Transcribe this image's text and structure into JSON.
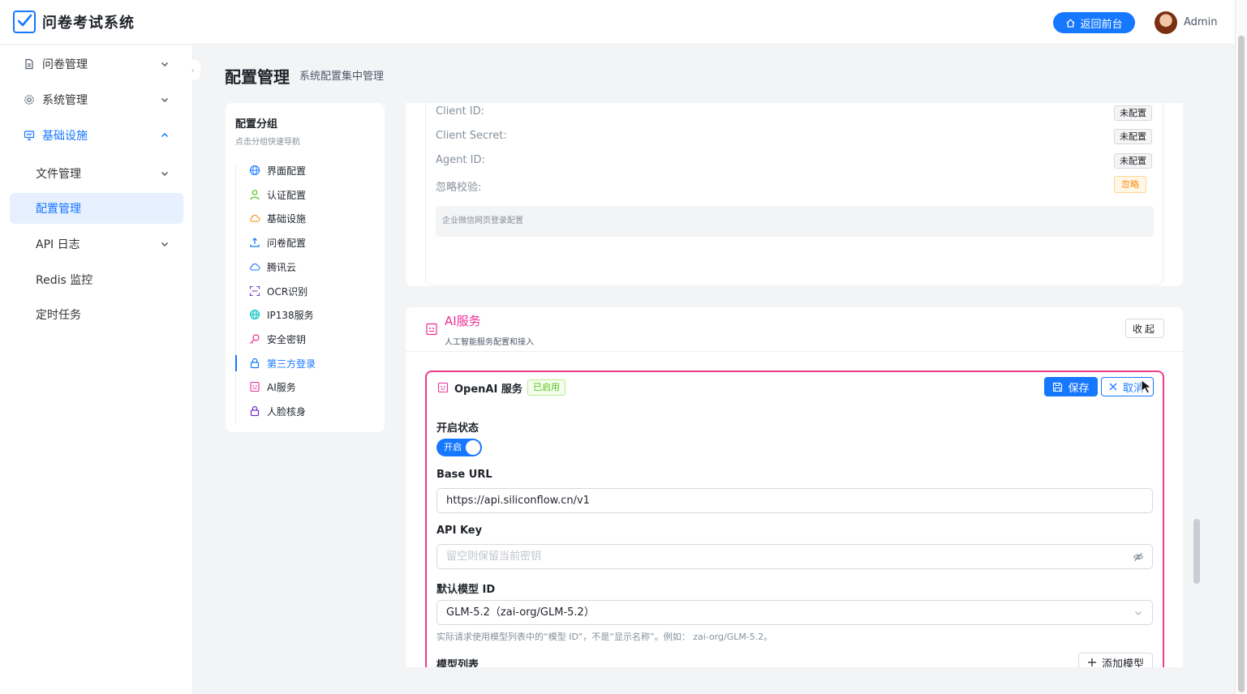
{
  "app": {
    "title": "问卷考试系统",
    "back_label": "返回前台",
    "user_name": "Admin"
  },
  "sidebar": {
    "items": [
      {
        "label": "问卷管理",
        "icon": "document-icon",
        "expandable": true
      },
      {
        "label": "系统管理",
        "icon": "gear-icon",
        "expandable": true
      },
      {
        "label": "基础设施",
        "icon": "monitor-icon",
        "expandable": true,
        "expanded": true
      },
      {
        "label": "文件管理",
        "expandable": true
      },
      {
        "label": "配置管理",
        "selected": true
      },
      {
        "label": "API 日志",
        "expandable": true
      },
      {
        "label": "Redis 监控"
      },
      {
        "label": "定时任务"
      }
    ]
  },
  "page": {
    "title": "配置管理",
    "subtitle": "系统配置集中管理"
  },
  "groups": {
    "title": "配置分组",
    "hint": "点击分组快速导航",
    "items": [
      {
        "label": "界面配置",
        "icon": "globe-icon",
        "color": "#1677ff"
      },
      {
        "label": "认证配置",
        "icon": "user-icon",
        "color": "#52c41a"
      },
      {
        "label": "基础设施",
        "icon": "cloud-icon",
        "color": "#fa8c16"
      },
      {
        "label": "问卷配置",
        "icon": "upload-icon",
        "color": "#1677ff"
      },
      {
        "label": "腾讯云",
        "icon": "cloud-icon",
        "color": "#1677ff"
      },
      {
        "label": "OCR识别",
        "icon": "scan-icon",
        "color": "#722ed1"
      },
      {
        "label": "IP138服务",
        "icon": "globe-icon",
        "color": "#13c2c2"
      },
      {
        "label": "安全密钥",
        "icon": "key-icon",
        "color": "#eb2f96"
      },
      {
        "label": "第三方登录",
        "icon": "lock-icon",
        "color": "#1677ff",
        "active": true
      },
      {
        "label": "AI服务",
        "icon": "robot-icon",
        "color": "#eb2f96"
      },
      {
        "label": "人脸核身",
        "icon": "lock-icon",
        "color": "#722ed1"
      }
    ]
  },
  "wechat": {
    "fields": [
      {
        "label": "Client ID:",
        "value": "未配置"
      },
      {
        "label": "Client Secret:",
        "value": "未配置"
      },
      {
        "label": "Agent ID:",
        "value": "未配置"
      },
      {
        "label": "忽略校验:",
        "value": "忽略"
      }
    ],
    "description": "企业微信网页登录配置"
  },
  "ai": {
    "title": "AI服务",
    "subtitle": "人工智能服务配置和接入",
    "collapse_label": "收起",
    "openai": {
      "title": "OpenAI 服务",
      "status_tag": "已启用",
      "save_label": "保存",
      "cancel_label": "取消",
      "enabled_label": "开启状态",
      "switch_text": "开启",
      "base_url_label": "Base URL",
      "base_url_value": "https://api.siliconflow.cn/v1",
      "api_key_label": "API Key",
      "api_key_placeholder": "留空则保留当前密钥",
      "model_label": "默认模型 ID",
      "model_value": "GLM-5.2（zai-org/GLM-5.2）",
      "model_hint": "实际请求使用模型列表中的“模型 ID”，不是“显示名称”。例如： zai-org/GLM-5.2。",
      "model_list_label": "模型列表",
      "add_model_label": "添加模型"
    }
  },
  "colors": {
    "primary": "#1677ff",
    "accent_pink": "#eb2f96"
  }
}
